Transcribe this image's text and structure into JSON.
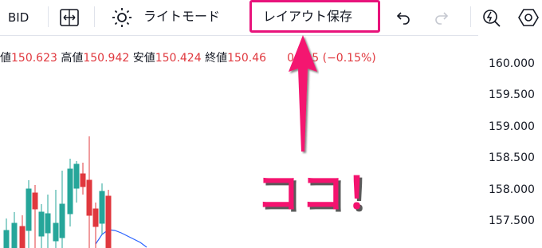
{
  "toolbar": {
    "bid_label": "BID",
    "theme_label": "ライトモード",
    "save_layout_label": "レイアウト保存"
  },
  "ohlc": {
    "open_label": "値",
    "open_value": "150.623",
    "high_label": "高値",
    "high_value": "150.942",
    "low_label": "安値",
    "low_value": "150.424",
    "close_label": "終値",
    "close_value": "150.46",
    "change_value": "0.225 (−0.15%)"
  },
  "price_axis": {
    "ticks": [
      "160.000",
      "159.500",
      "159.000",
      "158.500",
      "158.000",
      "157.500"
    ]
  },
  "annotation": {
    "callout_text": "ココ！"
  },
  "colors": {
    "accent_pink": "#e8137b",
    "down_red": "#e0383e",
    "up_green": "#26a69a",
    "ma_blue": "#2962ff"
  }
}
